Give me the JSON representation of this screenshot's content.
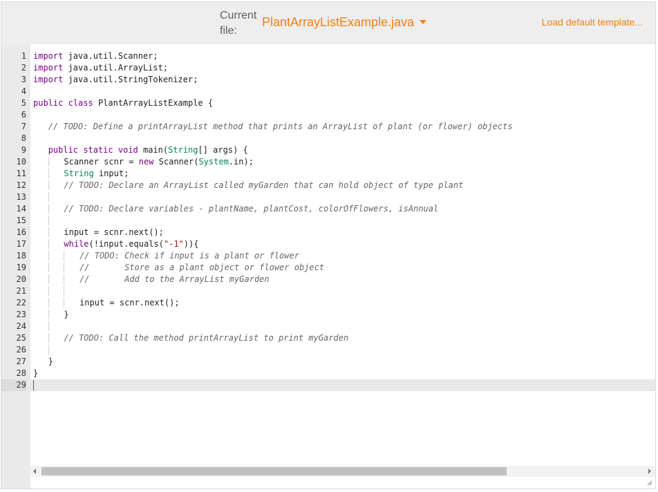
{
  "header": {
    "current_file_label": "Current file:",
    "file_name": "PlantArrayListExample.java",
    "load_default": "Load default template..."
  },
  "editor": {
    "lines": [
      {
        "n": "1"
      },
      {
        "n": "2"
      },
      {
        "n": "3"
      },
      {
        "n": "4"
      },
      {
        "n": "5"
      },
      {
        "n": "6"
      },
      {
        "n": "7"
      },
      {
        "n": "8"
      },
      {
        "n": "9"
      },
      {
        "n": "10"
      },
      {
        "n": "11"
      },
      {
        "n": "12"
      },
      {
        "n": "13"
      },
      {
        "n": "14"
      },
      {
        "n": "15"
      },
      {
        "n": "16"
      },
      {
        "n": "17"
      },
      {
        "n": "18"
      },
      {
        "n": "19"
      },
      {
        "n": "20"
      },
      {
        "n": "21"
      },
      {
        "n": "22"
      },
      {
        "n": "23"
      },
      {
        "n": "24"
      },
      {
        "n": "25"
      },
      {
        "n": "26"
      },
      {
        "n": "27"
      },
      {
        "n": "28"
      },
      {
        "n": "29"
      }
    ],
    "tokens": {
      "import": "import",
      "l1": " java.util.Scanner;",
      "l2": " java.util.ArrayList;",
      "l3": " java.util.StringTokenizer;",
      "public": "public",
      "class": "class",
      "l5": " PlantArrayListExample {",
      "c7": "// TODO: Define a printArrayList method that prints an ArrayList of plant (or flower) objects",
      "static": "static",
      "void": "void",
      "l9a": " main(",
      "String": "String",
      "l9b": "[] args) {",
      "l10a": "Scanner scnr = ",
      "new": "new",
      "l10b": " Scanner(",
      "System": "System",
      "l10c": ".in);",
      "l11": " input;",
      "c12": "// TODO: Declare an ArrayList called myGarden that can hold object of type plant",
      "c14": "// TODO: Declare variables - plantName, plantCost, colorOfFlowers, isAnnual",
      "l16": "input = scnr.next();",
      "while": "while",
      "l17a": "(!input.equals(",
      "s17": "\"-1\"",
      "l17b": ")){",
      "c18": "// TODO: Check if input is a plant or flower",
      "c19": "//       Store as a plant object or flower object",
      "c20": "//       Add to the ArrayList myGarden",
      "l22": "input = scnr.next();",
      "close": "}",
      "c25": "// TODO: Call the method printArrayList to print myGarden"
    }
  }
}
